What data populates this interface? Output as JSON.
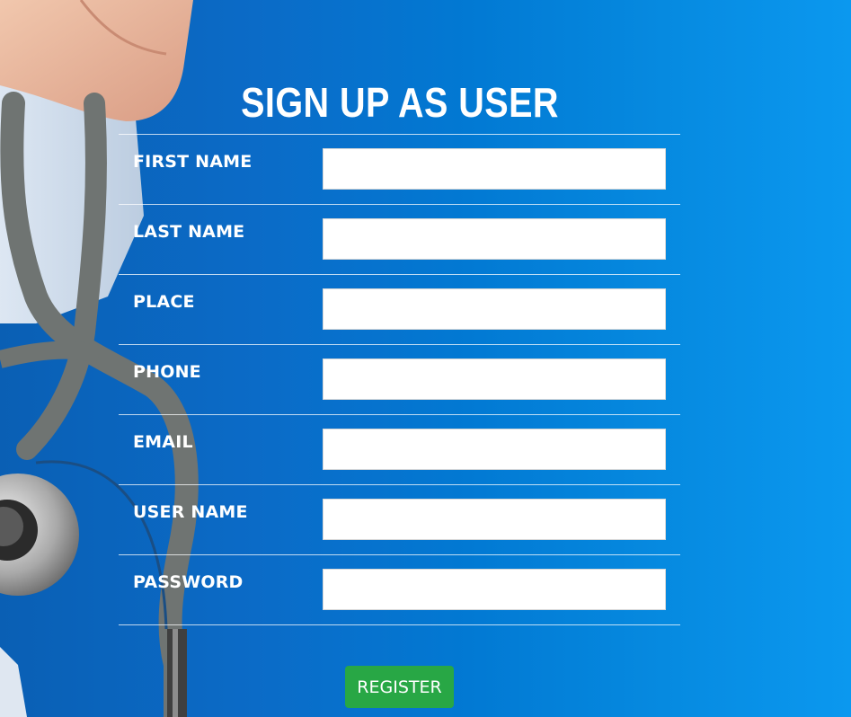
{
  "page": {
    "title": "SIGN UP AS USER"
  },
  "form": {
    "fields": [
      {
        "label": "FIRST NAME",
        "value": "",
        "placeholder": ""
      },
      {
        "label": "LAST NAME",
        "value": "",
        "placeholder": ""
      },
      {
        "label": "PLACE",
        "value": "",
        "placeholder": ""
      },
      {
        "label": "PHONE",
        "value": "",
        "placeholder": ""
      },
      {
        "label": "EMAIL",
        "value": "",
        "placeholder": ""
      },
      {
        "label": "USER NAME",
        "value": "",
        "placeholder": ""
      },
      {
        "label": "PASSWORD",
        "value": "",
        "placeholder": ""
      }
    ],
    "submit_label": "REGISTER"
  },
  "colors": {
    "background_blue": "#0279d3",
    "register_green": "#28a745",
    "text_white": "#ffffff"
  },
  "background_image": {
    "subject": "doctor-holding-stethoscope"
  }
}
